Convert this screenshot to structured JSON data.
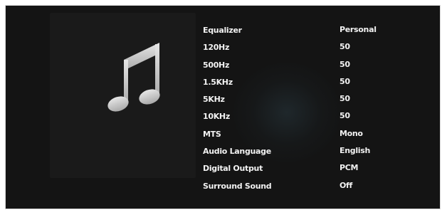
{
  "screen": {
    "icon": "music-note-icon",
    "menu_items": [
      {
        "label": "Equalizer",
        "value": "Personal"
      },
      {
        "label": "120Hz",
        "value": "50"
      },
      {
        "label": "500Hz",
        "value": "50"
      },
      {
        "label": "1.5KHz",
        "value": "50"
      },
      {
        "label": "5KHz",
        "value": "50"
      },
      {
        "label": "10KHz",
        "value": "50"
      },
      {
        "label": "MTS",
        "value": "Mono"
      },
      {
        "label": "Audio Language",
        "value": "English"
      },
      {
        "label": "Digital Output",
        "value": "PCM"
      },
      {
        "label": "Surround Sound",
        "value": "Off"
      }
    ]
  },
  "colors": {
    "background": "#141414",
    "text": "#f2f2f2",
    "icon": "#c8c8c8"
  }
}
